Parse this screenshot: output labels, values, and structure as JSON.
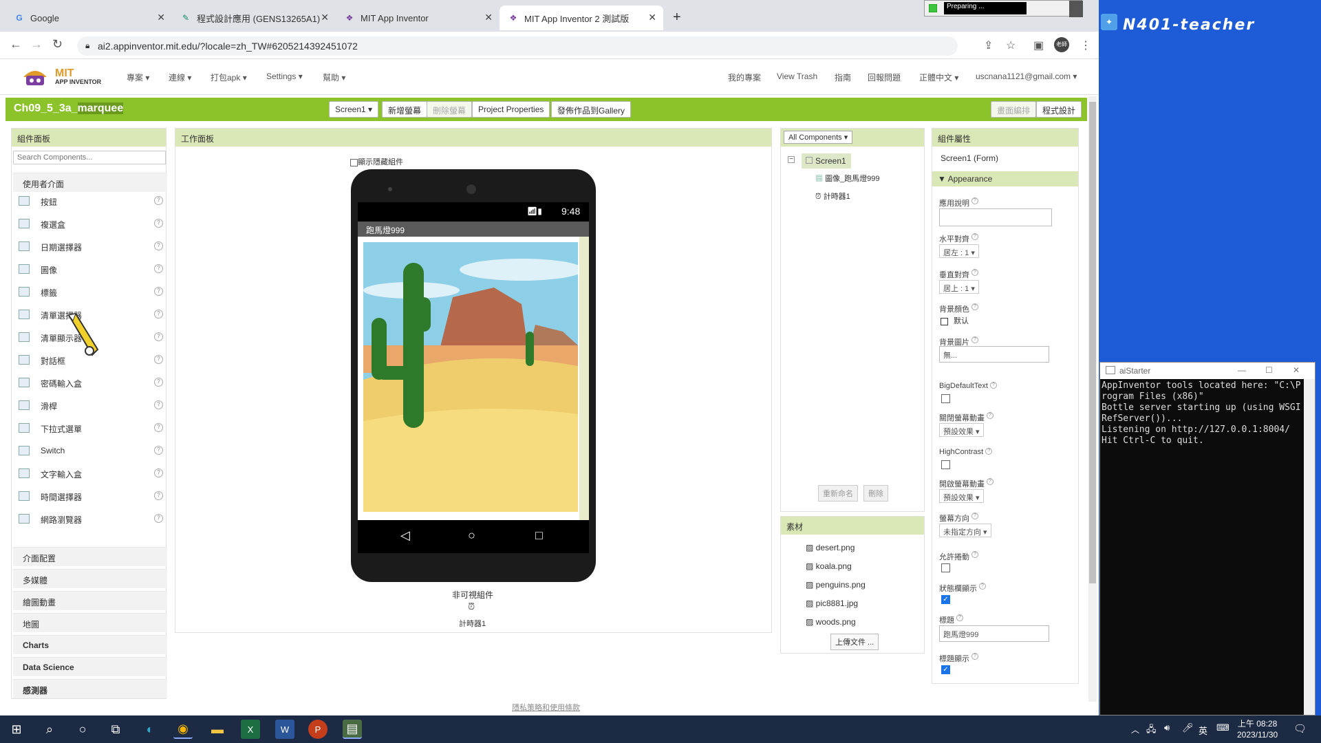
{
  "browser": {
    "tabs": [
      {
        "title": "Google",
        "icon": "google-icon"
      },
      {
        "title": "程式設計應用 (GENS13265A1)",
        "icon": "app-icon"
      },
      {
        "title": "MIT App Inventor",
        "icon": "mit-icon"
      },
      {
        "title": "MIT App Inventor 2 測試版",
        "icon": "mit-icon"
      }
    ],
    "url": "ai2.appinventor.mit.edu/?locale=zh_TW#6205214392451072",
    "preparing": "Preparing ...",
    "profile": "老師"
  },
  "header": {
    "logo_main": "MIT",
    "logo_sub": "APP INVENTOR",
    "menus": [
      "專案",
      "連線",
      "打包apk",
      "Settings",
      "幫助"
    ],
    "right_links": [
      "我的專案",
      "View Trash",
      "指南",
      "回報問題",
      "正體中文",
      "uscnana1121@gmail.com"
    ]
  },
  "project": {
    "name_prefix": "Ch09_5_3a_",
    "name_highlight": "marquee",
    "screen_select": "Screen1",
    "buttons": [
      "新增螢幕",
      "刪除螢幕",
      "Project Properties",
      "發佈作品到Gallery"
    ],
    "right_buttons": [
      "畫面編排",
      "程式設計"
    ]
  },
  "palette": {
    "title": "組件面板",
    "search_placeholder": "Search Components...",
    "category_open": "使用者介面",
    "items": [
      "按鈕",
      "複選盒",
      "日期選擇器",
      "圖像",
      "標籤",
      "清單選擇器",
      "清單顯示器",
      "對話框",
      "密碼輸入盒",
      "滑桿",
      "下拉式選單",
      "Switch",
      "文字輸入盒",
      "時間選擇器",
      "網路瀏覽器"
    ],
    "categories": [
      "介面配置",
      "多媒體",
      "繪圖動畫",
      "地圖",
      "Charts",
      "Data Science",
      "感測器"
    ]
  },
  "viewer": {
    "title": "工作面板",
    "show_hidden": "顯示隱藏組件",
    "time": "9:48",
    "app_title": "跑馬燈999",
    "nonvisible_label": "非可視組件",
    "nonvisible_item": "計時器1"
  },
  "components": {
    "select": "All Components",
    "tree": [
      "Screen1",
      "圖像_跑馬燈999",
      "計時器1"
    ],
    "rename": "重新命名",
    "delete": "刪除"
  },
  "media": {
    "title": "素材",
    "files": [
      "desert.png",
      "koala.png",
      "penguins.png",
      "pic8881.jpg",
      "woods.png"
    ],
    "upload": "上傳文件 ..."
  },
  "properties": {
    "title": "組件屬性",
    "component": "Screen1 (Form)",
    "section": "Appearance",
    "fields": {
      "about": "應用說明",
      "align_h": "水平對齊",
      "align_h_val": "居左 : 1",
      "align_v": "垂直對齊",
      "align_v_val": "居上 : 1",
      "bgcolor": "背景顏色",
      "bgcolor_val": "默认",
      "bgimage": "背景圖片",
      "bgimage_val": "無...",
      "bigtext": "BigDefaultText",
      "close_anim": "關閉螢幕動畫",
      "close_anim_val": "預設效果",
      "highcontrast": "HighContrast",
      "open_anim": "開啟螢幕動畫",
      "open_anim_val": "預設效果",
      "orientation": "螢幕方向",
      "orientation_val": "未指定方向",
      "scroll": "允許捲動",
      "statusbar": "狀態欄顯示",
      "title": "標題",
      "title_val": "跑馬燈999",
      "titlevisible": "標題顯示"
    }
  },
  "footer": {
    "privacy": "隱私策略和使用條款"
  },
  "desktop": {
    "label": "N401-teacher",
    "aistarter_title": "aiStarter",
    "console": "AppInventor tools located here: \"C:\\P\nrogram Files (x86)\"\nBottle server starting up (using WSGI\nRefServer())...\nListening on http://127.0.0.1:8004/\nHit Ctrl-C to quit."
  },
  "taskbar": {
    "time": "上午 08:28",
    "date": "2023/11/30",
    "ime": "英"
  }
}
